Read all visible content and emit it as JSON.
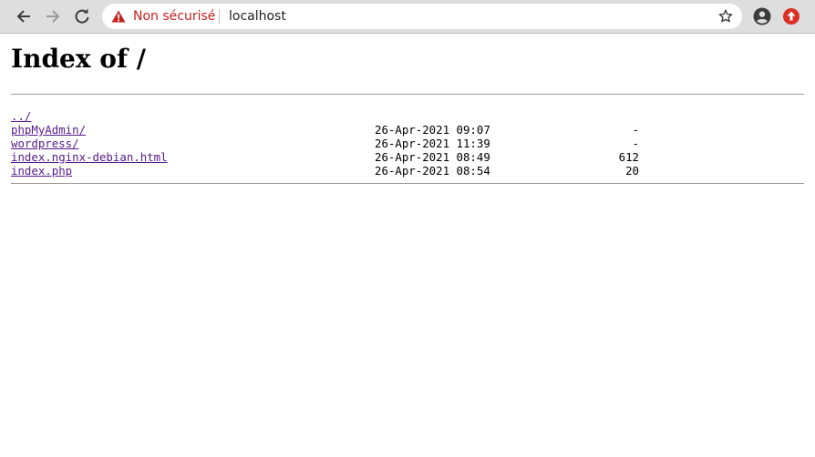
{
  "browser": {
    "security_label": "Non sécurisé",
    "url": "localhost",
    "accent_warning": "#c5221f",
    "update_color": "#d93025"
  },
  "page": {
    "title": "Index of /",
    "parent": {
      "name": "../"
    },
    "entries": [
      {
        "name": "phpMyAdmin/",
        "date": "26-Apr-2021 09:07",
        "size": "-"
      },
      {
        "name": "wordpress/",
        "date": "26-Apr-2021 11:39",
        "size": "-"
      },
      {
        "name": "index.nginx-debian.html",
        "date": "26-Apr-2021 08:49",
        "size": "612"
      },
      {
        "name": "index.php",
        "date": "26-Apr-2021 08:54",
        "size": "20"
      }
    ]
  }
}
